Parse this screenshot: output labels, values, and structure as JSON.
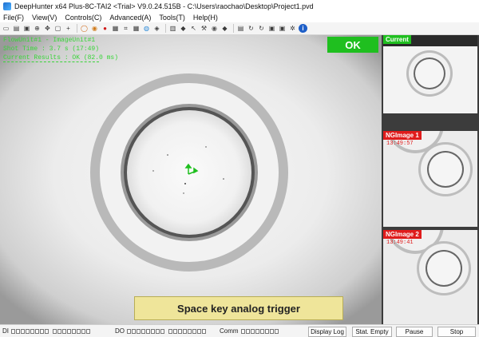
{
  "window": {
    "title": "DeepHunter x64 Plus-8C-TAI2 <Trial> V9.0.24.515B - C:\\Users\\raochao\\Desktop\\Project1.pvd"
  },
  "menu": [
    "File(F)",
    "View(V)",
    "Controls(C)",
    "Advanced(A)",
    "Tools(T)",
    "Help(H)"
  ],
  "toolbar_icons": [
    "new-file-icon",
    "open-folder-icon",
    "save-icon",
    "zoom-icon",
    "move-icon",
    "fit-window-icon",
    "crosshair-icon",
    "run-icon",
    "pause-icon",
    "record-icon",
    "camera-icon",
    "crop-icon",
    "grid-icon",
    "color-icon",
    "settings-icon",
    "layers-icon",
    "tag-icon",
    "cursor-icon",
    "tool-icon",
    "location-icon",
    "tag-icon",
    "print-icon",
    "sync-icon",
    "sync-icon",
    "save-icon",
    "device-icon",
    "gear-icon",
    "info-icon"
  ],
  "main": {
    "flow_unit": "FlowUnit#1 - ImageUnit#1",
    "shot_time": "Shot Time : 3.7 s (17:49)",
    "current_results": "Current Results : OK (82.0 ms)",
    "result_badge": "OK",
    "trigger_label": "Space key analog trigger"
  },
  "side": {
    "panels": [
      {
        "tag": "Current",
        "timestamp": "",
        "tag_color": "#1fbf1f"
      },
      {
        "tag": "NGImage 1",
        "timestamp": "13:49:57",
        "tag_color": "#e01c1c"
      },
      {
        "tag": "NGImage 2",
        "timestamp": "13:49:41",
        "tag_color": "#e01c1c"
      }
    ]
  },
  "status": {
    "di_label": "DI",
    "do_label": "DO",
    "comm_label": "Comm",
    "buttons": [
      "Display Log",
      "Stat. Empty",
      "Pause",
      "Stop"
    ]
  }
}
